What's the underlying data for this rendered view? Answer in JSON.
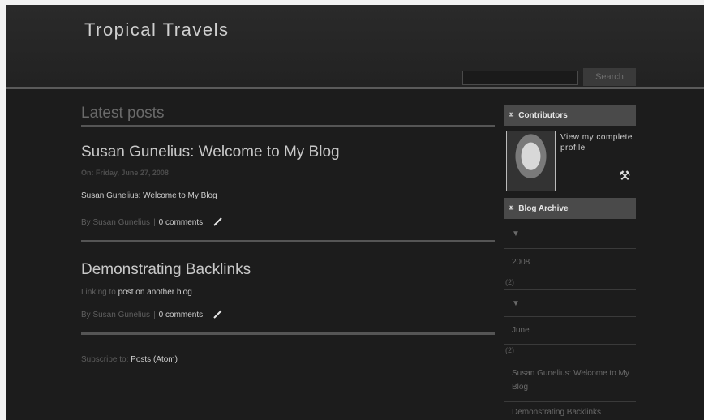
{
  "site": {
    "title": "Tropical Travels"
  },
  "search": {
    "button_label": "Search",
    "value": ""
  },
  "main": {
    "section_heading": "Latest posts",
    "posts": [
      {
        "title": "Susan Gunelius: Welcome to My Blog",
        "date": "On: Friday, June 27, 2008",
        "body": "Susan Gunelius: Welcome to My Blog",
        "author": "By Susan Gunelius",
        "separator": "|",
        "comments": "0 comments"
      },
      {
        "title": "Demonstrating Backlinks",
        "body_prefix": "Linking to",
        "body_link": "post on another blog",
        "author": "By Susan Gunelius",
        "separator": "|",
        "comments": "0 comments"
      }
    ],
    "subscribe_prefix": "Subscribe to:",
    "subscribe_link": "Posts (Atom)"
  },
  "sidebar": {
    "contributors_title": "Contributors",
    "profile_link": "View my complete profile",
    "archive_title": "Blog Archive",
    "archive": {
      "year": "2008",
      "year_count": "(2)",
      "month": "June",
      "month_count": "(2)",
      "posts": [
        "Susan Gunelius: Welcome to My Blog",
        "Demonstrating Backlinks"
      ]
    }
  },
  "icons": {
    "section_header_icon": "contributors-header-icon",
    "edit_icon": "pencil-icon",
    "tools_icon": "tools-icon",
    "toggle_icon": "triangle-down-icon"
  }
}
